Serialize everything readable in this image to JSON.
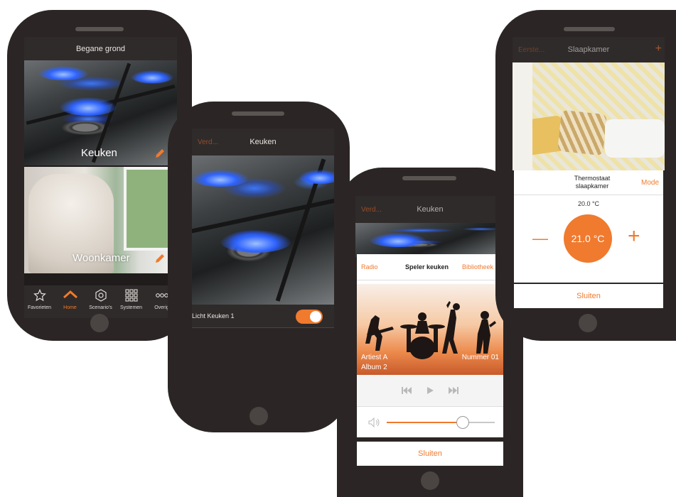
{
  "phone1": {
    "title": "Begane grond",
    "rooms": [
      {
        "label": "Keuken"
      },
      {
        "label": "Woonkamer"
      }
    ],
    "nav": [
      {
        "label": "Favorieten",
        "icon": "star-icon"
      },
      {
        "label": "Home",
        "icon": "home-icon"
      },
      {
        "label": "Scenario's",
        "icon": "scenario-icon"
      },
      {
        "label": "Systemen",
        "icon": "grid-icon"
      },
      {
        "label": "Overig",
        "icon": "more-icon"
      }
    ],
    "nav_active": "Home"
  },
  "phone2": {
    "back_label": "Verd...",
    "title": "Keuken",
    "light_label": "Licht Keuken 1",
    "light_on": true
  },
  "phone3": {
    "back_label": "Verd...",
    "title": "Keuken",
    "tabs": {
      "left": "Radio",
      "center": "Speler keuken",
      "right": "Bibliotheek"
    },
    "artist": "Artiest A",
    "album": "Album 2",
    "track": "Nummer 01",
    "volume_fraction": 0.7,
    "close_label": "Sluiten"
  },
  "phone4": {
    "back_label": "Eerste...",
    "title": "Slaapkamer",
    "plus": "+",
    "thermostat_title": "Thermostaat slaapkamer",
    "mode_label": "Mode",
    "measured_temp": "20.0 °C",
    "setpoint": "21.0 °C",
    "minus_sign": "—",
    "plus_sign": "+",
    "close_label": "Sluiten"
  },
  "colors": {
    "accent": "#f07a2e",
    "phone_body": "#2b2625",
    "bar": "#2f2b2a"
  }
}
